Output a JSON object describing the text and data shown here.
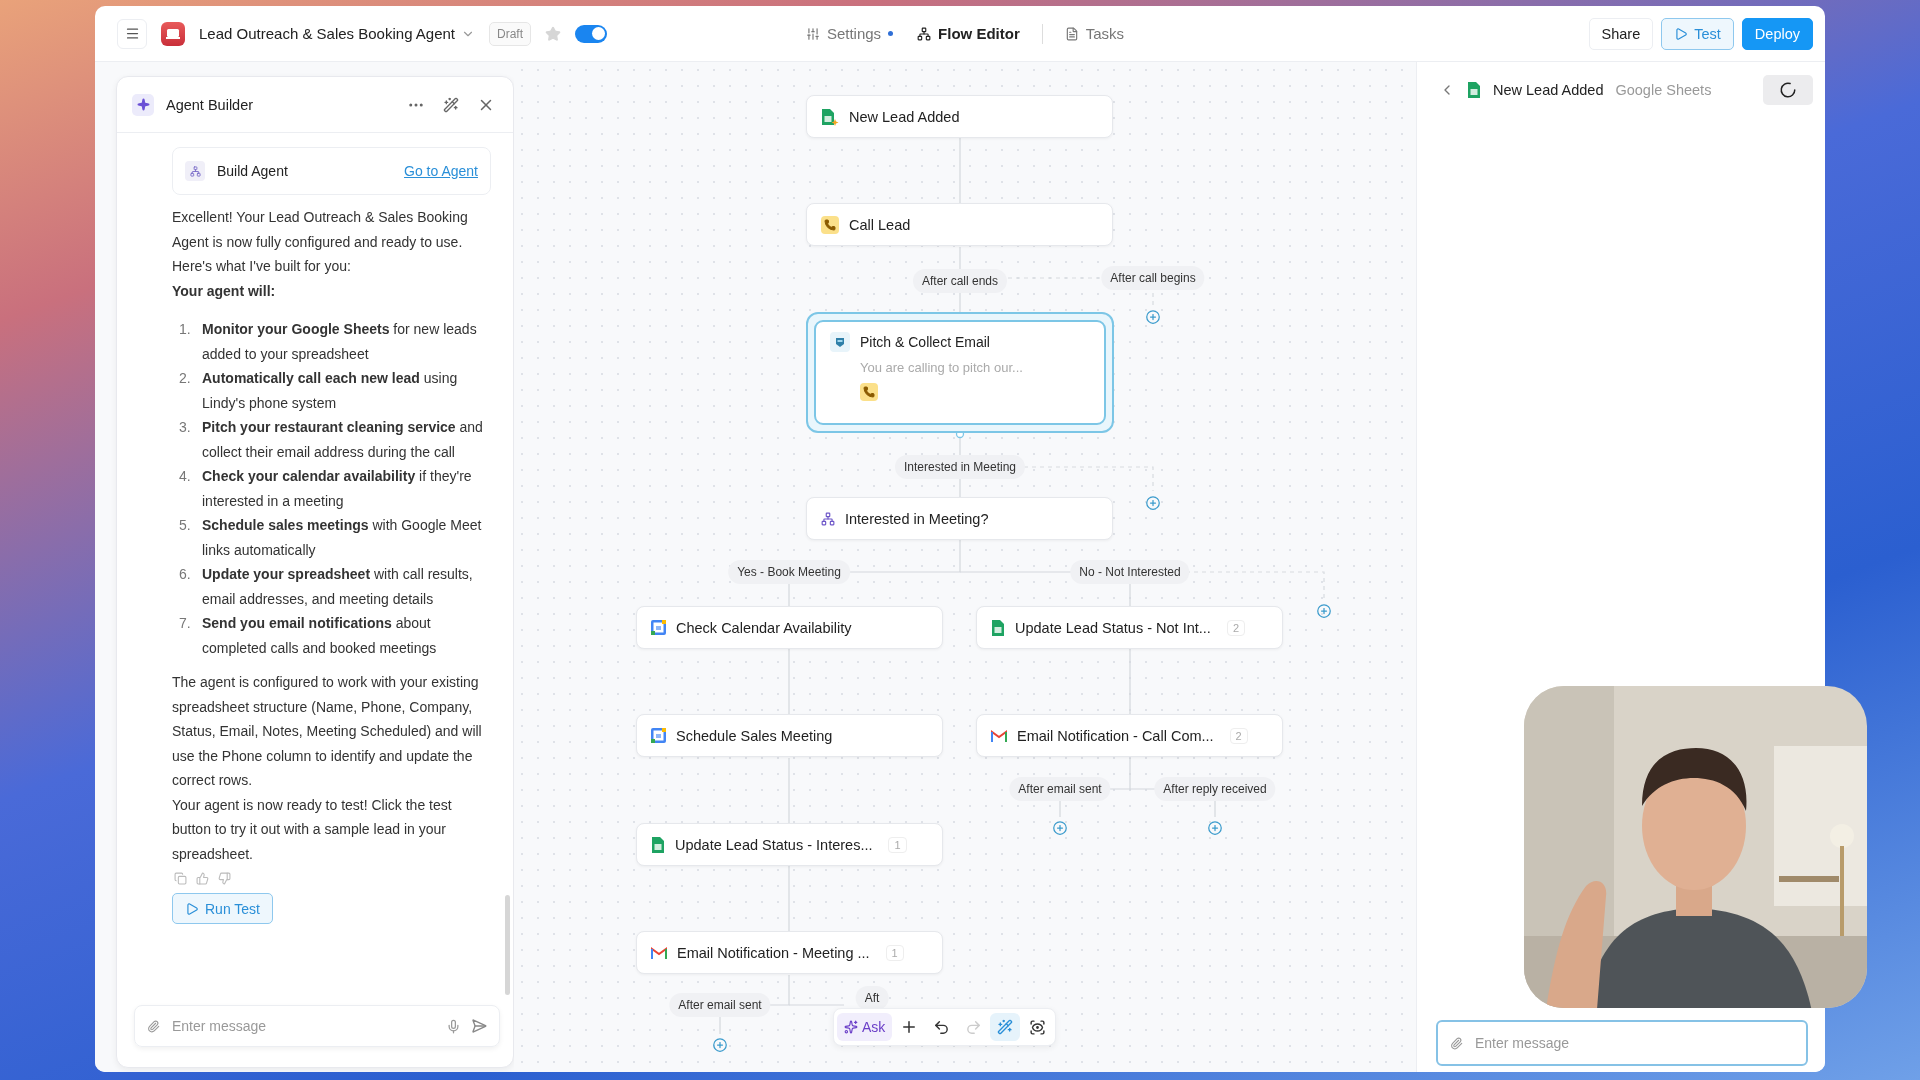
{
  "app_bar": {
    "title": "Lead Outreach & Sales Booking Agent",
    "status": "Draft",
    "starred": false,
    "enabled": true,
    "nav": [
      {
        "label": "Settings",
        "kind": "settings",
        "selected": false,
        "dot": true
      },
      {
        "label": "Flow Editor",
        "kind": "flow",
        "selected": true,
        "dot": false
      },
      {
        "label": "Tasks",
        "kind": "tasks",
        "selected": false,
        "dot": false
      }
    ],
    "actions": [
      {
        "label": "Share",
        "kind": "plain"
      },
      {
        "label": "Test",
        "kind": "outline"
      },
      {
        "label": "Deploy",
        "kind": "primary"
      }
    ]
  },
  "agent_builder": {
    "title": "Agent Builder",
    "tool_card": {
      "label": "Build Agent",
      "link": "Go to Agent"
    },
    "intro": "Excellent! Your Lead Outreach & Sales Booking Agent is now fully configured and ready to use. Here's what I've built for you:",
    "lead": "Your agent will:",
    "steps": [
      {
        "number": "1.",
        "text": "**Monitor your Google Sheets** for new leads added to your spreadsheet"
      },
      {
        "number": "2.",
        "text": "**Automatically call each new lead** using Lindy's phone system"
      },
      {
        "number": "3.",
        "text": "**Pitch your restaurant cleaning service** and collect their email address during the call"
      },
      {
        "number": "4.",
        "text": "**Check your calendar availability** if they're interested in a meeting"
      },
      {
        "number": "5.",
        "text": "**Schedule sales meetings** with Google Meet links automatically"
      },
      {
        "number": "6.",
        "text": "**Update your spreadsheet** with call results, email addresses, and meeting details"
      },
      {
        "number": "7.",
        "text": "**Send you email notifications** about completed calls and booked meetings"
      }
    ],
    "paragraphs": [
      "The agent is configured to work with your existing spreadsheet structure (Name, Phone, Company, Status, Email, Notes, Meeting Scheduled) and will use the Phone column to identify and update the correct rows.",
      "Your agent is now ready to test! Click the test button to try it out with a sample lead in your spreadsheet."
    ],
    "run_button": "Run Test",
    "input": {
      "placeholder": "Enter message"
    }
  },
  "flow": {
    "nodes": [
      {
        "label": "New Lead Added",
        "selected": false
      },
      {
        "label": "Call Lead",
        "selected": false
      },
      {
        "label": "Pitch & Collect Email",
        "subtitle": "You are calling to pitch our...",
        "selected": true
      },
      {
        "label": "Interested in Meeting?",
        "selected": false
      },
      {
        "label": "Check Calendar Availability",
        "selected": false
      },
      {
        "label": "Update Lead Status - Not Int...",
        "count": "2",
        "selected": false
      },
      {
        "label": "Schedule Sales Meeting",
        "selected": false
      },
      {
        "label": "Email Notification - Call Com...",
        "count": "2",
        "selected": false
      },
      {
        "label": "Update Lead Status - Interes...",
        "count": "1",
        "selected": false
      },
      {
        "label": "Email Notification - Meeting ...",
        "count": "1",
        "selected": false
      }
    ],
    "edge_labels": [
      "After call ends",
      "After call begins",
      "Interested in Meeting",
      "Yes - Book Meeting",
      "No - Not Interested",
      "After email sent",
      "After reply received",
      "After email sent",
      "Aft"
    ]
  },
  "canvas_toolbar": {
    "ask": "Ask",
    "tools": [
      {
        "kind": "add",
        "selected": false,
        "disabled": false
      },
      {
        "kind": "undo",
        "selected": false,
        "disabled": false
      },
      {
        "kind": "redo",
        "selected": false,
        "disabled": true
      },
      {
        "kind": "tidy",
        "selected": true,
        "disabled": false
      },
      {
        "kind": "fit",
        "selected": false,
        "disabled": false
      }
    ]
  },
  "detail_panel": {
    "title": "New Lead Added",
    "app": "Google Sheets",
    "input": {
      "placeholder": "Enter message"
    }
  }
}
